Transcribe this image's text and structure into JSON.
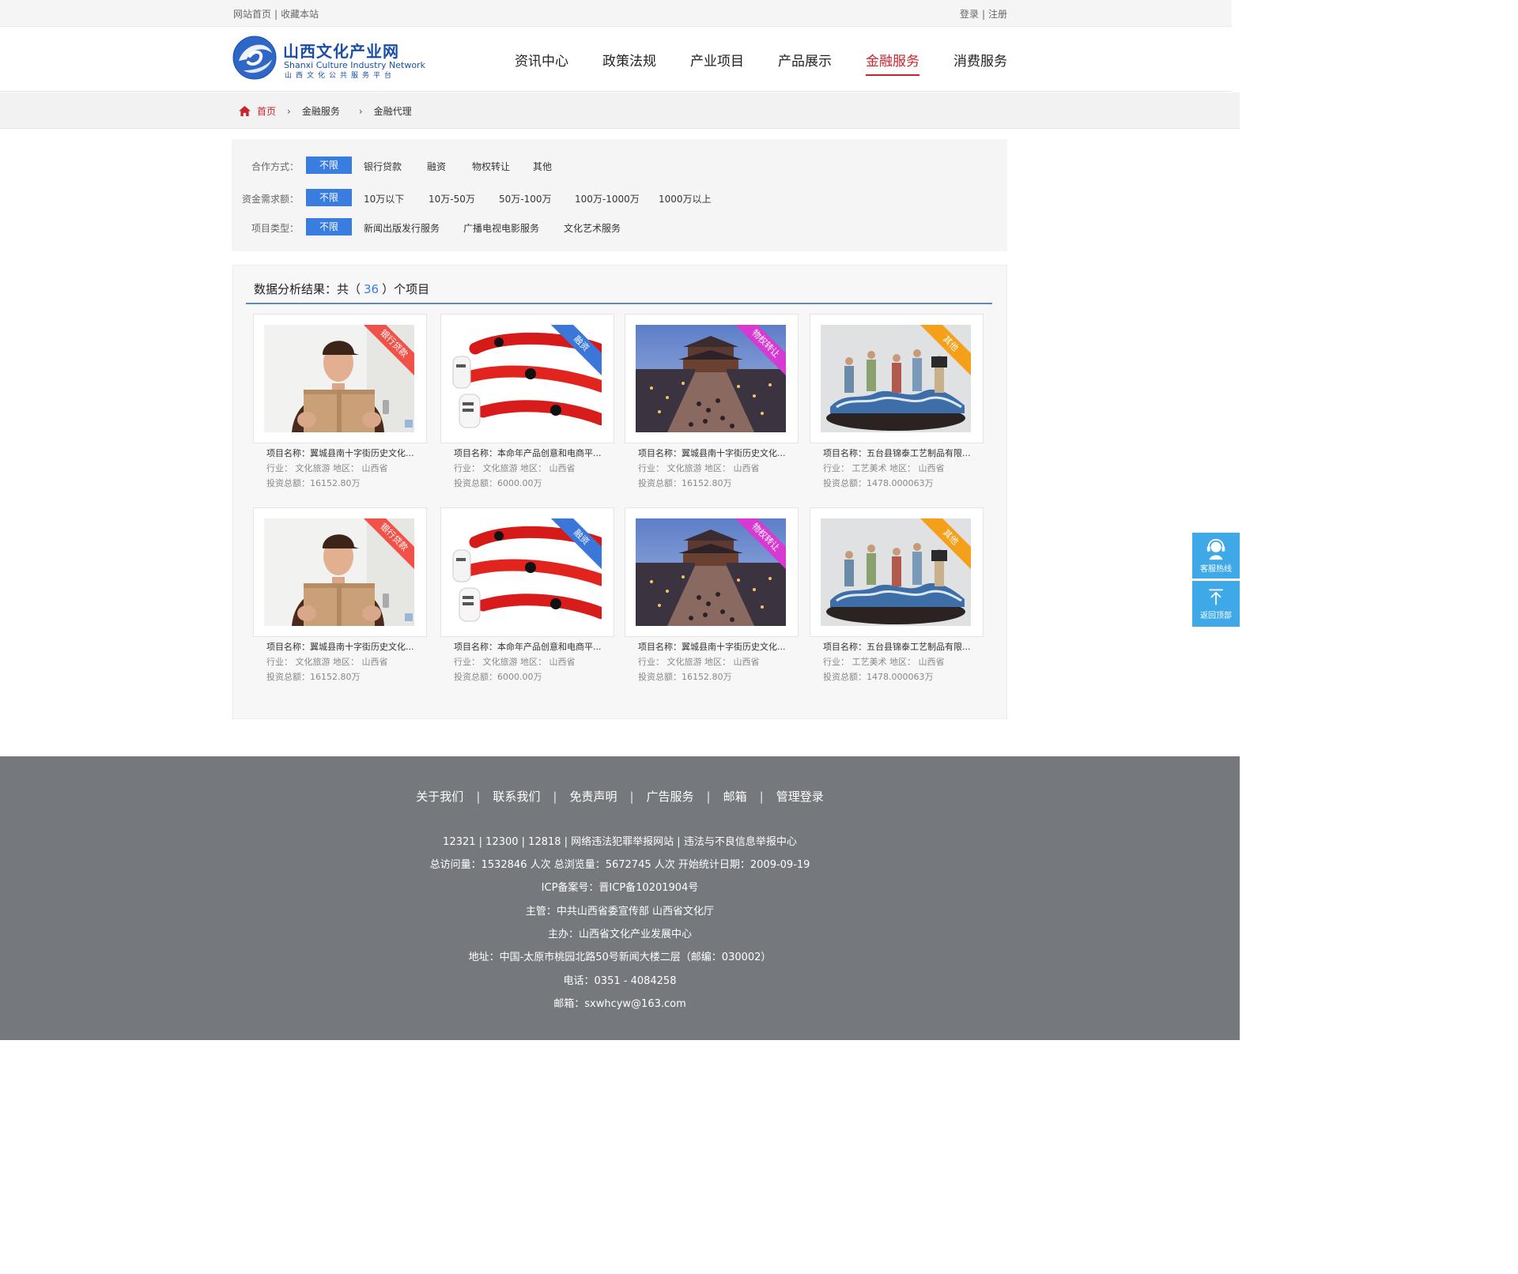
{
  "topbar": {
    "home": "网站首页",
    "favorite": "收藏本站",
    "login": "登录",
    "register": "注册"
  },
  "logo": {
    "title": "山西文化产业网",
    "en": "Shanxi Culture Industry Network",
    "sub": "山西文化公共服务平台"
  },
  "nav": [
    "资讯中心",
    "政策法规",
    "产业项目",
    "产品展示",
    "金融服务",
    "消费服务"
  ],
  "nav_active": "金融服务",
  "breadcrumb": {
    "home": "首页",
    "level1": "金融服务",
    "level2": "金融代理"
  },
  "filters": {
    "coop": {
      "label": "合作方式：",
      "options": [
        "不限",
        "银行贷款",
        "融资",
        "物权转让",
        "其他"
      ]
    },
    "amount": {
      "label": "资金需求额：",
      "options": [
        "不限",
        "10万以下",
        "10万-50万",
        "50万-100万",
        "100万-1000万",
        "1000万以上"
      ]
    },
    "type": {
      "label": "项目类型：",
      "options": [
        "不限",
        "新闻出版发行服务",
        "广播电视电影服务",
        "文化艺术服务"
      ]
    }
  },
  "results": {
    "prefix": "数据分析结果：共（",
    "count": "36",
    "suffix": "）个项目"
  },
  "cards": [
    {
      "tag": "银行贷款",
      "tag_color": "#f0524a",
      "image": "delivery-man",
      "name": "项目名称：翼城县南十字街历史文化...",
      "industry": "行业： 文化旅游 地区： 山西省",
      "invest": "投资总额：16152.80万"
    },
    {
      "tag": "融资",
      "tag_color": "#3b77d8",
      "image": "red-beads",
      "name": "项目名称：本命年产品创意和电商平...",
      "industry": "行业： 文化旅游 地区： 山西省",
      "invest": "投资总额：6000.00万"
    },
    {
      "tag": "物权转让",
      "tag_color": "#d63ad2",
      "image": "ancient-street",
      "name": "项目名称：翼城县南十字街历史文化...",
      "industry": "行业： 文化旅游 地区： 山西省",
      "invest": "投资总额：16152.80万"
    },
    {
      "tag": "其他",
      "tag_color": "#f5a01a",
      "image": "figurine-sculpture",
      "name": "项目名称：五台县锦泰工艺制品有限...",
      "industry": "行业： 工艺美术 地区： 山西省",
      "invest": "投资总额：1478.000063万"
    },
    {
      "tag": "银行贷款",
      "tag_color": "#f0524a",
      "image": "delivery-man",
      "name": "项目名称：翼城县南十字街历史文化...",
      "industry": "行业： 文化旅游 地区： 山西省",
      "invest": "投资总额：16152.80万"
    },
    {
      "tag": "融资",
      "tag_color": "#3b77d8",
      "image": "red-beads",
      "name": "项目名称：本命年产品创意和电商平...",
      "industry": "行业： 文化旅游 地区： 山西省",
      "invest": "投资总额：6000.00万"
    },
    {
      "tag": "物权转让",
      "tag_color": "#d63ad2",
      "image": "ancient-street",
      "name": "项目名称：翼城县南十字街历史文化...",
      "industry": "行业： 文化旅游 地区： 山西省",
      "invest": "投资总额：16152.80万"
    },
    {
      "tag": "其他",
      "tag_color": "#f5a01a",
      "image": "figurine-sculpture",
      "name": "项目名称：五台县锦泰工艺制品有限...",
      "industry": "行业： 工艺美术 地区： 山西省",
      "invest": "投资总额：1478.000063万"
    }
  ],
  "footer": {
    "links": [
      "关于我们",
      "联系我们",
      "免责声明",
      "广告服务",
      "邮箱",
      "管理登录"
    ],
    "hotlines": "12321 | 12300 | 12818 | 网络违法犯罪举报网站 | 违法与不良信息举报中心",
    "stats": "总访问量：1532846 人次 总浏览量：5672745 人次 开始统计日期：2009-09-19",
    "icp": "ICP备案号：晋ICP备10201904号",
    "supervisor": "主管：中共山西省委宣传部 山西省文化厅",
    "host": "主办：山西省文化产业发展中心",
    "address": "地址：中国-太原市桃园北路50号新闻大楼二层（邮编：030002）",
    "phone": "电话：0351 - 4084258",
    "email": "邮箱：sxwhcyw@163.com"
  },
  "side": {
    "service": "客服热线",
    "top": "返回顶部"
  }
}
